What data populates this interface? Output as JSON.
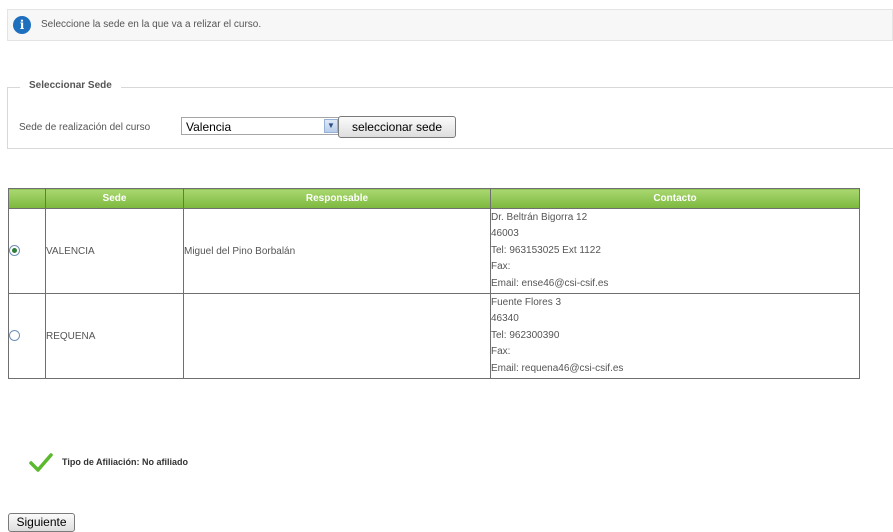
{
  "info": {
    "icon": "info-icon",
    "message": "Seleccione la sede en la que va a relizar el curso."
  },
  "select_sede": {
    "legend": "Seleccionar Sede",
    "label": "Sede de realización del curso",
    "selected": "Valencia",
    "button": "seleccionar sede"
  },
  "table": {
    "headers": [
      "",
      "Sede",
      "Responsable",
      "Contacto"
    ],
    "header_color": "#8cc44f",
    "rows": [
      {
        "selected": true,
        "sede": "VALENCIA",
        "responsable": "Miguel del Pino Borbalán",
        "contacto": [
          "Dr. Beltrán Bigorra 12",
          "46003",
          "Tel: 963153025 Ext 1122",
          "Fax:",
          "Email: ense46@csi-csif.es"
        ]
      },
      {
        "selected": false,
        "sede": "REQUENA",
        "responsable": "",
        "contacto": [
          "Fuente Flores 3",
          "46340",
          "Tel: 962300390",
          "Fax:",
          "Email: requena46@csi-csif.es"
        ]
      }
    ]
  },
  "affiliation": {
    "icon": "check-icon",
    "text": "Tipo de Afiliación: No afiliado"
  },
  "next_button": "Siguiente"
}
